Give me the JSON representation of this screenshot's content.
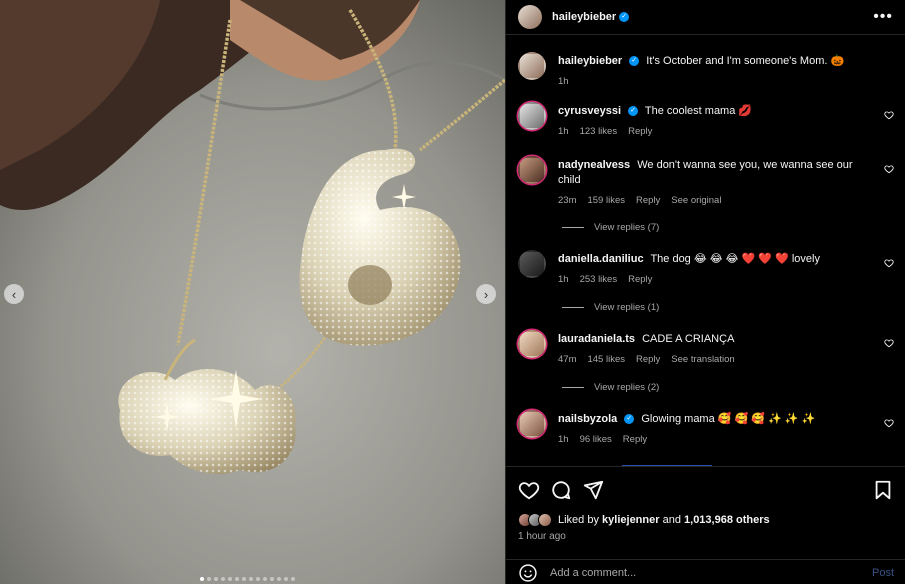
{
  "header": {
    "username": "haileybieber",
    "more_label": "•••"
  },
  "caption": {
    "username": "haileybieber",
    "text": "It's October and I'm someone's Mom. 🎃",
    "time": "1h"
  },
  "comments": [
    {
      "username": "cyrusveyssi",
      "verified": true,
      "text": "The coolest mama 💋",
      "time": "1h",
      "likes": "123 likes",
      "reply": "Reply",
      "extra": ""
    },
    {
      "username": "nadynealvess",
      "verified": false,
      "text": "We don't wanna see you, we wanna see our child",
      "time": "23m",
      "likes": "159 likes",
      "reply": "Reply",
      "extra": "See original",
      "replies": "View replies (7)"
    },
    {
      "username": "daniella.daniliuc",
      "verified": false,
      "text": "The dog 😂 😂 😂 ❤️ ❤️ ❤️ lovely",
      "time": "1h",
      "likes": "253 likes",
      "reply": "Reply",
      "extra": "",
      "replies": "View replies (1)"
    },
    {
      "username": "lauradaniela.ts",
      "verified": false,
      "text": "CADE A CRIANÇA",
      "time": "47m",
      "likes": "145 likes",
      "reply": "Reply",
      "extra": "See translation",
      "replies": "View replies (2)"
    },
    {
      "username": "nailsbyzola",
      "verified": true,
      "text": "Glowing mama 🥰 🥰 🥰 ✨ ✨ ✨",
      "time": "1h",
      "likes": "96 likes",
      "reply": "Reply",
      "extra": ""
    }
  ],
  "likes_line": {
    "prefix": "Liked by",
    "user": "kyliejenner",
    "and": "and",
    "others": "1,013,968 others"
  },
  "post_time": "1 hour ago",
  "add_comment": {
    "placeholder": "Add a comment...",
    "post_label": "Post"
  },
  "carousel": {
    "prev_label": "‹",
    "next_label": "›",
    "dot_count": 14,
    "active_index": 0
  },
  "colors": {
    "verified": "#0095f6",
    "post_link": "#385185",
    "secondary_text": "#a8a8a8"
  }
}
